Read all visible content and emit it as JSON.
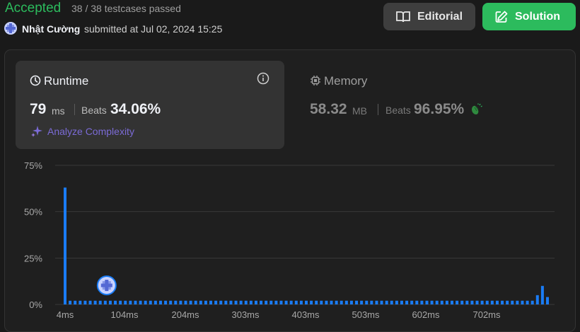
{
  "header": {
    "status": "Accepted",
    "testcases": "38 / 38 testcases passed",
    "user": "Nhật Cường",
    "submitted": "submitted at Jul 02, 2024 15:25",
    "editorial_label": "Editorial",
    "solution_label": "Solution"
  },
  "runtime": {
    "title": "Runtime",
    "value": "79",
    "unit": "ms",
    "beats_label": "Beats",
    "beats_pct": "34.06%",
    "analyze_label": "Analyze Complexity"
  },
  "memory": {
    "title": "Memory",
    "value": "58.32",
    "unit": "MB",
    "beats_label": "Beats",
    "beats_pct": "96.95%"
  },
  "colors": {
    "accent_green": "#2cbb5d",
    "bar_blue": "#1a7cf5",
    "analyze_purple": "#7b6bd6"
  },
  "chart_data": {
    "type": "bar",
    "xlabel": "",
    "ylabel": "",
    "ylim": [
      0,
      75
    ],
    "y_ticks": [
      "75%",
      "50%",
      "25%",
      "0%"
    ],
    "x_tick_labels": [
      "4ms",
      "104ms",
      "204ms",
      "303ms",
      "403ms",
      "503ms",
      "602ms",
      "702ms"
    ],
    "grid": true,
    "marker_label": "your submission at 79 ms",
    "values": [
      63,
      2,
      2,
      2,
      2,
      2,
      2,
      2,
      2,
      2,
      2,
      2,
      2,
      2,
      2,
      2,
      2,
      2,
      2,
      2,
      2,
      2,
      2,
      2,
      2,
      2,
      2,
      2,
      2,
      2,
      2,
      2,
      2,
      2,
      2,
      2,
      2,
      2,
      2,
      2,
      2,
      2,
      2,
      2,
      2,
      2,
      2,
      2,
      2,
      2,
      2,
      2,
      2,
      2,
      2,
      2,
      2,
      2,
      2,
      2,
      2,
      2,
      2,
      2,
      2,
      2,
      2,
      2,
      2,
      2,
      2,
      2,
      2,
      2,
      2,
      2,
      2,
      2,
      2,
      2,
      2,
      2,
      2,
      2,
      2,
      2,
      2,
      2,
      2,
      2,
      2,
      2,
      2,
      2,
      5,
      10,
      4
    ],
    "marker_index": 8
  }
}
